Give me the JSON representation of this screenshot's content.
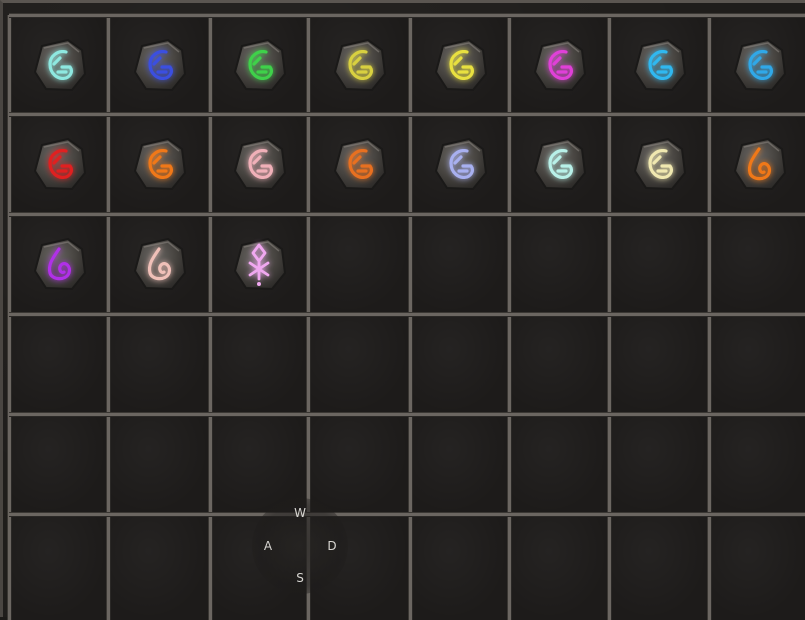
{
  "inventory": {
    "slots": [
      {
        "icon": "g-rune-cyan-icon",
        "glow": "#8ee8e0"
      },
      {
        "icon": "g-rune-blue-icon",
        "glow": "#3b4fe0"
      },
      {
        "icon": "g-rune-green-icon",
        "glow": "#3fd14a"
      },
      {
        "icon": "g-rune-olive-icon",
        "glow": "#d8d040"
      },
      {
        "icon": "g-rune-yellow-icon",
        "glow": "#e8e040"
      },
      {
        "icon": "g-rune-magenta-icon",
        "glow": "#e040d8"
      },
      {
        "icon": "g-rune-skyblue-icon",
        "glow": "#30b8f0"
      },
      {
        "icon": "g-rune-azure-icon",
        "glow": "#30a8e8"
      },
      {
        "icon": "g-rune-red-icon",
        "glow": "#e02020"
      },
      {
        "icon": "g-rune-orange-icon",
        "glow": "#f07818"
      },
      {
        "icon": "g-rune-pink-icon",
        "glow": "#f0b0b8"
      },
      {
        "icon": "g-rune-amber-icon",
        "glow": "#e87020"
      },
      {
        "icon": "g-rune-lavender-icon",
        "glow": "#a8b0f0"
      },
      {
        "icon": "g-rune-mint-icon",
        "glow": "#b8f0e8"
      },
      {
        "icon": "g-rune-cream-icon",
        "glow": "#f0e8b0"
      },
      {
        "icon": "flame-rune-orange-icon",
        "glow": "#f07818"
      },
      {
        "icon": "flame-rune-purple-icon",
        "glow": "#b030e8"
      },
      {
        "icon": "flame-rune-pale-pink-icon",
        "glow": "#f0c0b8"
      },
      {
        "icon": "sigil-rune-pink-icon",
        "glow": "#f0a8f0"
      }
    ]
  },
  "movement_keys": {
    "up": "W",
    "left": "A",
    "right": "D",
    "down": "S"
  }
}
